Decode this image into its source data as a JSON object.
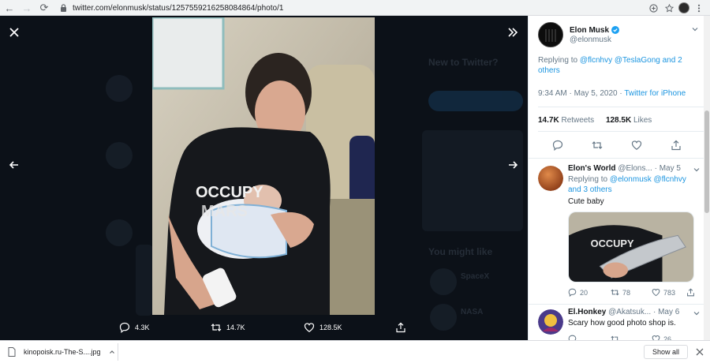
{
  "browser": {
    "url": "twitter.com/elonmusk/status/1257559216258084864/photo/1",
    "back_label": "←",
    "forward_label": "→",
    "reload_label": "⟳"
  },
  "viewer": {
    "background_hints": {
      "new_to_twitter": "New to Twitter?",
      "you_might_like": "You might like",
      "spacex": "SpaceX",
      "nasa": "NASA"
    },
    "actions": {
      "replies": "4.3K",
      "retweets": "14.7K",
      "likes": "128.5K"
    },
    "photo_shirt_text_1": "OCCUPY",
    "photo_shirt_text_2": "MARS"
  },
  "tweet": {
    "author_name": "Elon Musk",
    "author_handle": "@elonmusk",
    "replying_prefix": "Replying to ",
    "replying_users": "@flcnhvy @TeslaGong",
    "replying_suffix": " and 2 others",
    "time": "9:34 AM · May 5, 2020 · ",
    "source": "Twitter for iPhone",
    "retweets_count": "14.7K",
    "retweets_label": " Retweets",
    "likes_count": "128.5K",
    "likes_label": " Likes"
  },
  "replies": [
    {
      "name": "Elon's World",
      "handle": "@Elons...",
      "date": "· May 5",
      "replying_prefix": "Replying to ",
      "replying_users": "@elonmusk @flcnhvy",
      "replying_suffix": "and 3 others",
      "text": "Cute baby",
      "media_text": "OCCUPY",
      "replies": "20",
      "retweets": "78",
      "likes": "783"
    },
    {
      "name": "El.Honkey",
      "handle": "@Akatsuk...",
      "date": "· May 6",
      "text": "Scary how good photo shop is.",
      "replies": "",
      "retweets": "",
      "likes": "26"
    }
  ],
  "downloads": {
    "file_name": "kinopoisk.ru-The-S....jpg",
    "show_all": "Show all"
  },
  "colors": {
    "link": "#1b95e0",
    "viewer_bg": "#0c1118"
  }
}
